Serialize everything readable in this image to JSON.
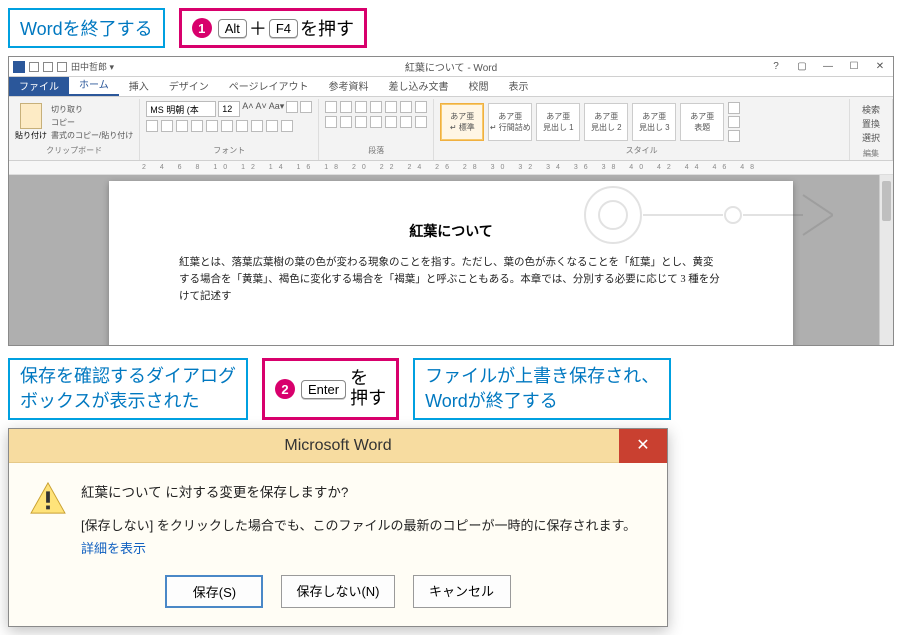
{
  "callouts": {
    "title": "Wordを終了する",
    "step1_key1": "Alt",
    "step1_plus": "＋",
    "step1_key2": "F4",
    "step1_suffix": "を押す",
    "dialog_shown_l1": "保存を確認するダイアログ",
    "dialog_shown_l2": "ボックスが表示された",
    "step2_key": "Enter",
    "step2_suffix_l1": "を",
    "step2_suffix_l2": "押す",
    "result_l1": "ファイルが上書き保存され、",
    "result_l2": "Wordが終了する"
  },
  "word": {
    "title": "紅葉について - Word",
    "user": "田中哲郎 ▾",
    "tabs": {
      "file": "ファイル",
      "home": "ホーム",
      "insert": "挿入",
      "design": "デザイン",
      "layout": "ページレイアウト",
      "references": "参考資料",
      "mailings": "差し込み文書",
      "review": "校閲",
      "view": "表示"
    },
    "ribbonSearch": {
      "l1": "検索",
      "l2": "置換",
      "l3": "選択"
    },
    "clipboard": {
      "cut": "切り取り",
      "copy": "コピー",
      "paste": "貼り付け",
      "format": "書式のコピー/貼り付け",
      "group": "クリップボード"
    },
    "font": {
      "name": "MS 明朝 (本",
      "size": "12",
      "group": "フォント"
    },
    "para": {
      "group": "段落"
    },
    "styles": {
      "sample": "あア亜",
      "s1": "↵ 標準",
      "s2": "↵ 行間詰め",
      "s3": "見出し 1",
      "s4": "見出し 2",
      "s5": "見出し 3",
      "s6": "表題",
      "group": "スタイル",
      "editGroup": "編集"
    },
    "doc": {
      "title": "紅葉について",
      "body": "紅葉とは、落葉広葉樹の葉の色が変わる現象のことを指す。ただし、葉の色が赤くなることを「紅葉」とし、黄変する場合を「黄葉」、褐色に変化する場合を「褐葉」と呼ぶこともある。本章では、分別する必要に応じて 3 種を分けて記述す"
    }
  },
  "dialog": {
    "title": "Microsoft Word",
    "message": "紅葉について に対する変更を保存しますか?",
    "sub": "[保存しない] をクリックした場合でも、このファイルの最新のコピーが一時的に保存されます。",
    "link": "詳細を表示",
    "save": "保存(S)",
    "dontsave": "保存しない(N)",
    "cancel": "キャンセル"
  }
}
